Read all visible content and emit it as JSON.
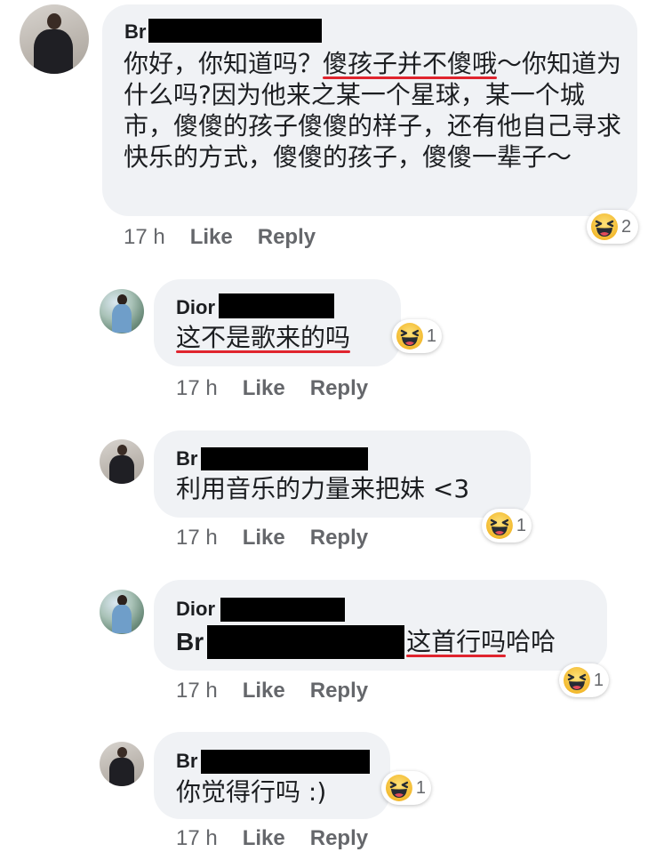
{
  "comments": [
    {
      "author": "Br",
      "text_parts": [
        "你好，你知道吗？",
        "傻孩子并不傻哦",
        "～你知道为什么吗?因为他来之某一个星球，某一个城市，傻傻的孩子傻傻的样子，还有他自己寻求快乐的方式，傻傻的孩子，傻傻一辈子～"
      ],
      "time": "17 h",
      "like": "Like",
      "reply": "Reply",
      "reaction_count": "2"
    },
    {
      "author": "Dior",
      "text": "这不是歌来的吗",
      "time": "17 h",
      "like": "Like",
      "reply": "Reply",
      "reaction_count": "1"
    },
    {
      "author": "Br",
      "text": "利用音乐的力量来把妹 <3",
      "time": "17 h",
      "like": "Like",
      "reply": "Reply",
      "reaction_count": "1"
    },
    {
      "author": "Dior",
      "mention": "Br",
      "text": "这首行吗",
      "text_tail": "哈哈",
      "time": "17 h",
      "like": "Like",
      "reply": "Reply",
      "reaction_count": "1"
    },
    {
      "author": "Br",
      "text": "你觉得行吗 :)",
      "time": "17 h",
      "like": "Like",
      "reply": "Reply",
      "reaction_count": "1"
    }
  ],
  "colors": {
    "bubble": "#f0f2f5",
    "underline": "#e0242e",
    "meta": "#65676b",
    "redaction": "#000000",
    "haha_emoji": "#f7c637"
  },
  "icons": [
    "avatar",
    "haha-reaction-icon"
  ]
}
